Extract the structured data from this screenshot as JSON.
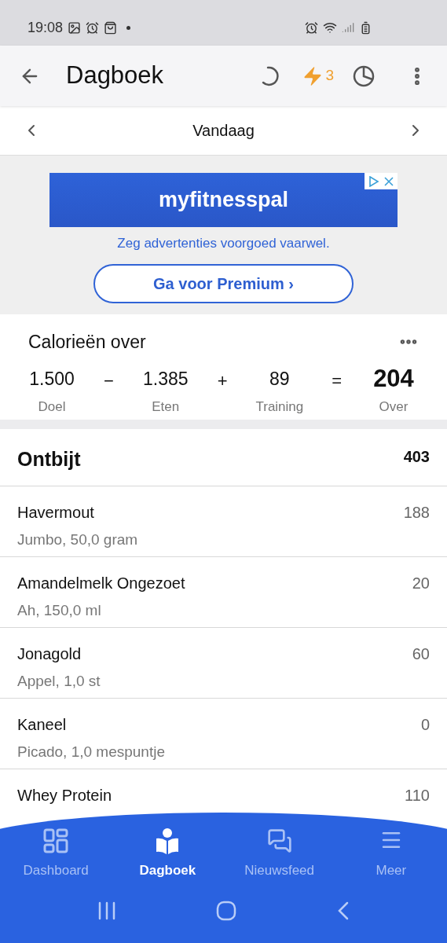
{
  "status_bar": {
    "time": "19:08"
  },
  "header": {
    "title": "Dagboek",
    "streak": "3"
  },
  "date_nav": {
    "label": "Vandaag"
  },
  "ad": {
    "brand": "myfitnesspal",
    "tagline": "Zeg advertenties voorgoed vaarwel.",
    "button": "Ga voor Premium ›"
  },
  "calories": {
    "title": "Calorieën over",
    "terms": [
      {
        "kind": "term",
        "value": "1.500",
        "label": "Doel"
      },
      {
        "kind": "operator",
        "value": "−"
      },
      {
        "kind": "term",
        "value": "1.385",
        "label": "Eten"
      },
      {
        "kind": "operator",
        "value": "+"
      },
      {
        "kind": "term",
        "value": "89",
        "label": "Training"
      },
      {
        "kind": "operator",
        "value": "="
      },
      {
        "kind": "result",
        "value": "204",
        "label": "Over"
      }
    ]
  },
  "meal": {
    "title": "Ontbijt",
    "total": "403",
    "items": [
      {
        "name": "Havermout",
        "detail": "Jumbo, 50,0 gram",
        "calories": "188"
      },
      {
        "name": "Amandelmelk Ongezoet",
        "detail": "Ah, 150,0 ml",
        "calories": "20"
      },
      {
        "name": "Jonagold",
        "detail": "Appel, 1,0 st",
        "calories": "60"
      },
      {
        "name": "Kaneel",
        "detail": "Picado, 1,0 mespuntje",
        "calories": "0"
      },
      {
        "name": "Whey Protein",
        "calories": "110"
      }
    ]
  },
  "bottom_nav": [
    {
      "kind": "dashboard",
      "label": "Dashboard",
      "selected": false
    },
    {
      "kind": "diary",
      "label": "Dagboek",
      "selected": true
    },
    {
      "kind": "feed",
      "label": "Nieuwsfeed",
      "selected": false
    },
    {
      "kind": "more",
      "label": "Meer",
      "selected": false
    }
  ]
}
